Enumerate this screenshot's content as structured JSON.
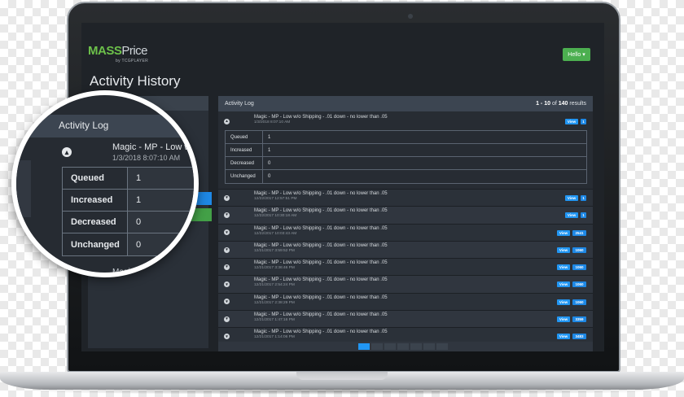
{
  "app": {
    "logo_mass": "MASS",
    "logo_price": "Price",
    "logo_sub": "by TCGPLAYER",
    "hello_label": "Hello",
    "page_title": "Activity History",
    "accent": "#6cc04a"
  },
  "log": {
    "header": "Activity Log",
    "range": "1 - 10",
    "of": "of",
    "total": "140",
    "results": "results",
    "expanded": {
      "title": "Magic - MP - Low w/o Shipping - .01 down - no lower than .05",
      "date": "1/3/2018 8:07:10 AM",
      "view": "View",
      "count": "1",
      "stats": [
        {
          "label": "Queued",
          "value": "1"
        },
        {
          "label": "Increased",
          "value": "1"
        },
        {
          "label": "Decreased",
          "value": "0"
        },
        {
          "label": "Unchanged",
          "value": "0"
        }
      ]
    },
    "rows": [
      {
        "title": "Magic - MP - Low w/o Shipping - .01 down - no lower than .05",
        "date": "12/22/2017 12:57:51 PM",
        "view": "View",
        "count": "1"
      },
      {
        "title": "Magic - MP - Low w/o Shipping - .01 down - no lower than .05",
        "date": "12/22/2017 10:30:18 AM",
        "view": "View",
        "count": "1"
      },
      {
        "title": "Magic - MP - Low w/o Shipping - .01 down - no lower than .05",
        "date": "12/22/2017 10:03:43 AM",
        "view": "View",
        "count": "2541"
      },
      {
        "title": "Magic - MP - Low w/o Shipping - .01 down - no lower than .05",
        "date": "12/21/2017 3:59:52 PM",
        "view": "View",
        "count": "1060"
      },
      {
        "title": "Magic - MP - Low w/o Shipping - .01 down - no lower than .05",
        "date": "12/21/2017 3:36:46 PM",
        "view": "View",
        "count": "1060"
      },
      {
        "title": "Magic - MP - Low w/o Shipping - .01 down - no lower than .05",
        "date": "12/21/2017 2:54:24 PM",
        "view": "View",
        "count": "1060"
      },
      {
        "title": "Magic - MP - Low w/o Shipping - .01 down - no lower than .05",
        "date": "12/21/2017 2:38:29 PM",
        "view": "View",
        "count": "1060"
      },
      {
        "title": "Magic - MP - Low w/o Shipping - .01 down - no lower than .05",
        "date": "12/21/2017 1:47:16 PM",
        "view": "View",
        "count": "3359"
      },
      {
        "title": "Magic - MP - Low w/o Shipping - .01 down - no lower than .05",
        "date": "12/21/2017 1:14:06 PM",
        "view": "View",
        "count": "3483"
      }
    ]
  },
  "magnifier": {
    "header": "Activity Log",
    "title": "Magic - MP - Low w",
    "date": "1/3/2018 8:07:10 AM",
    "stats": [
      {
        "label": "Queued",
        "value": "1"
      },
      {
        "label": "Increased",
        "value": "1"
      },
      {
        "label": "Decreased",
        "value": "0"
      },
      {
        "label": "Unchanged",
        "value": "0"
      }
    ],
    "bottom_text": "Magi"
  },
  "colors": {
    "view_button": "#2196f3",
    "hello_button": "#4caf50",
    "left_blue_button": "#1e88e5",
    "left_green_button": "#43a047"
  },
  "icons": {
    "row_toggle": "chevron-down-icon",
    "expanded_toggle": "chevron-up-icon",
    "hello_caret": "caret-down-icon"
  }
}
